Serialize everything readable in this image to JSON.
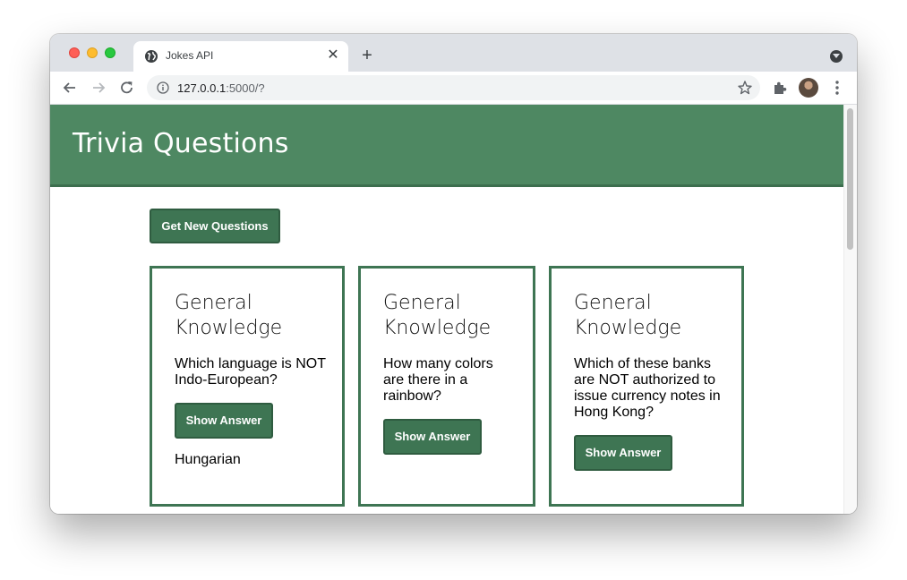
{
  "browser": {
    "tab_title": "Jokes API",
    "url_host": "127.0.0.1",
    "url_rest": ":5000/?"
  },
  "page": {
    "title": "Trivia Questions",
    "get_button": "Get New Questions",
    "cards": [
      {
        "category": "General Knowledge",
        "question": "Which language is NOT Indo-European?",
        "button": "Show Answer",
        "answer": "Hungarian"
      },
      {
        "category": "General Knowledge",
        "question": "How many colors are there in a rainbow?",
        "button": "Show Answer",
        "answer": ""
      },
      {
        "category": "General Knowledge",
        "question": "Which of these banks are NOT authorized to issue currency notes in Hong Kong?",
        "button": "Show Answer",
        "answer": ""
      }
    ]
  },
  "colors": {
    "header_bg": "#4e8862",
    "button_bg": "#3e7553",
    "card_border": "#3e7553"
  }
}
